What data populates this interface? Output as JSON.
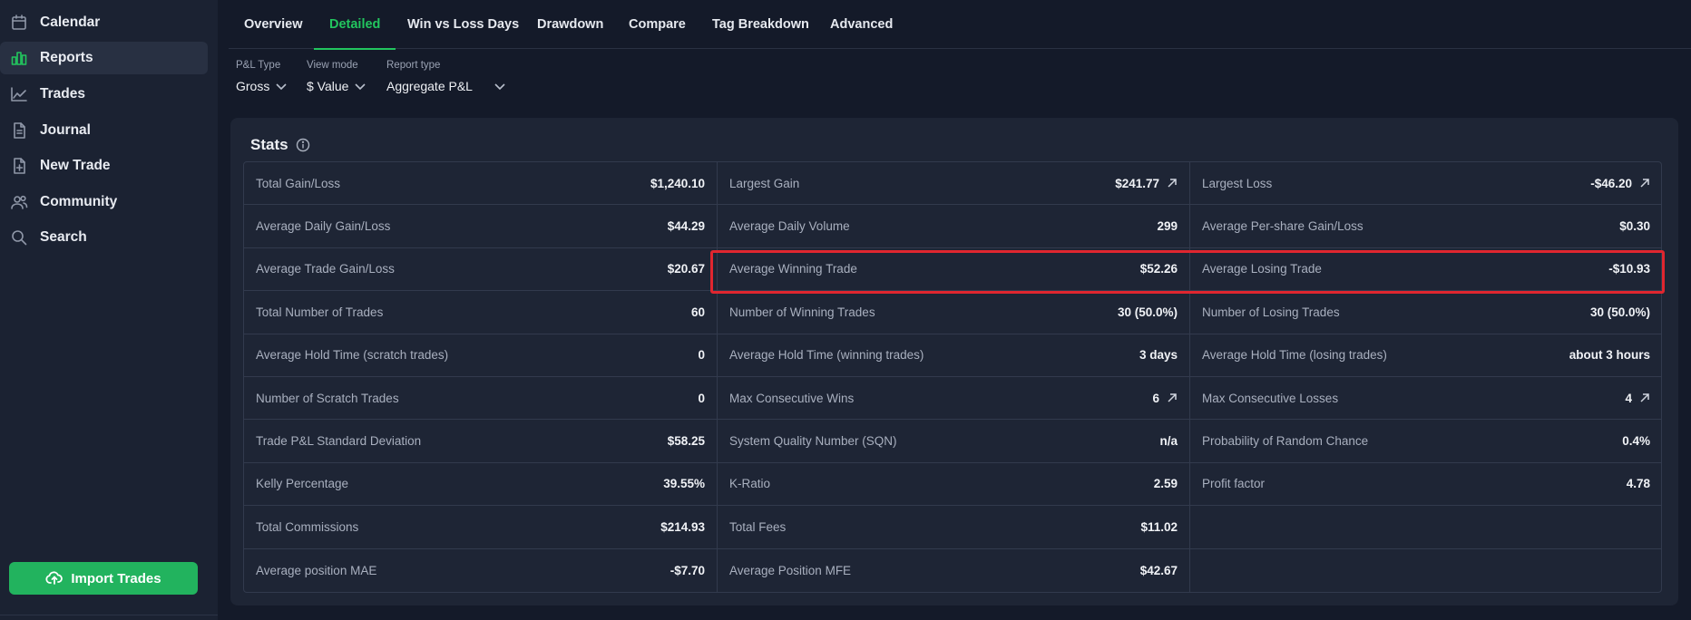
{
  "sidebar": {
    "items": [
      {
        "label": "Calendar",
        "icon": "calendar-icon"
      },
      {
        "label": "Reports",
        "icon": "bar-chart-icon",
        "active": true
      },
      {
        "label": "Trades",
        "icon": "line-chart-icon"
      },
      {
        "label": "Journal",
        "icon": "document-icon"
      },
      {
        "label": "New Trade",
        "icon": "file-plus-icon"
      },
      {
        "label": "Community",
        "icon": "users-icon"
      },
      {
        "label": "Search",
        "icon": "search-icon"
      }
    ],
    "import_label": "Import Trades"
  },
  "tabs": [
    "Overview",
    "Detailed",
    "Win vs Loss Days",
    "Drawdown",
    "Compare",
    "Tag Breakdown",
    "Advanced"
  ],
  "active_tab": "Detailed",
  "filters": [
    {
      "label": "P&L Type",
      "value": "Gross"
    },
    {
      "label": "View mode",
      "value": "$ Value"
    },
    {
      "label": "Report type",
      "value": "Aggregate P&L"
    }
  ],
  "stats": {
    "title": "Stats",
    "columns": [
      [
        {
          "label": "Total Gain/Loss",
          "value": "$1,240.10"
        },
        {
          "label": "Average Daily Gain/Loss",
          "value": "$44.29"
        },
        {
          "label": "Average Trade Gain/Loss",
          "value": "$20.67"
        },
        {
          "label": "Total Number of Trades",
          "value": "60"
        },
        {
          "label": "Average Hold Time (scratch trades)",
          "value": "0"
        },
        {
          "label": "Number of Scratch Trades",
          "value": "0"
        },
        {
          "label": "Trade P&L Standard Deviation",
          "value": "$58.25"
        },
        {
          "label": "Kelly Percentage",
          "value": "39.55%"
        },
        {
          "label": "Total Commissions",
          "value": "$214.93"
        },
        {
          "label": "Average position MAE",
          "value": "-$7.70"
        }
      ],
      [
        {
          "label": "Largest Gain",
          "value": "$241.77",
          "link": true
        },
        {
          "label": "Average Daily Volume",
          "value": "299"
        },
        {
          "label": "Average Winning Trade",
          "value": "$52.26"
        },
        {
          "label": "Number of Winning Trades",
          "value": "30 (50.0%)"
        },
        {
          "label": "Average Hold Time (winning trades)",
          "value": "3 days"
        },
        {
          "label": "Max Consecutive Wins",
          "value": "6",
          "link": true
        },
        {
          "label": "System Quality Number (SQN)",
          "value": "n/a"
        },
        {
          "label": "K-Ratio",
          "value": "2.59"
        },
        {
          "label": "Total Fees",
          "value": "$11.02"
        },
        {
          "label": "Average Position MFE",
          "value": "$42.67"
        }
      ],
      [
        {
          "label": "Largest Loss",
          "value": "-$46.20",
          "link": true
        },
        {
          "label": "Average Per-share Gain/Loss",
          "value": "$0.30"
        },
        {
          "label": "Average Losing Trade",
          "value": "-$10.93"
        },
        {
          "label": "Number of Losing Trades",
          "value": "30 (50.0%)"
        },
        {
          "label": "Average Hold Time (losing trades)",
          "value": "about 3 hours"
        },
        {
          "label": "Max Consecutive Losses",
          "value": "4",
          "link": true
        },
        {
          "label": "Probability of Random Chance",
          "value": "0.4%"
        },
        {
          "label": "Profit factor",
          "value": "4.78"
        },
        {
          "label": "",
          "value": ""
        },
        {
          "label": "",
          "value": ""
        }
      ]
    ]
  },
  "colors": {
    "accent": "#22c55e",
    "highlight": "#e0262f",
    "background": "#141a29",
    "card": "#1e2535"
  }
}
